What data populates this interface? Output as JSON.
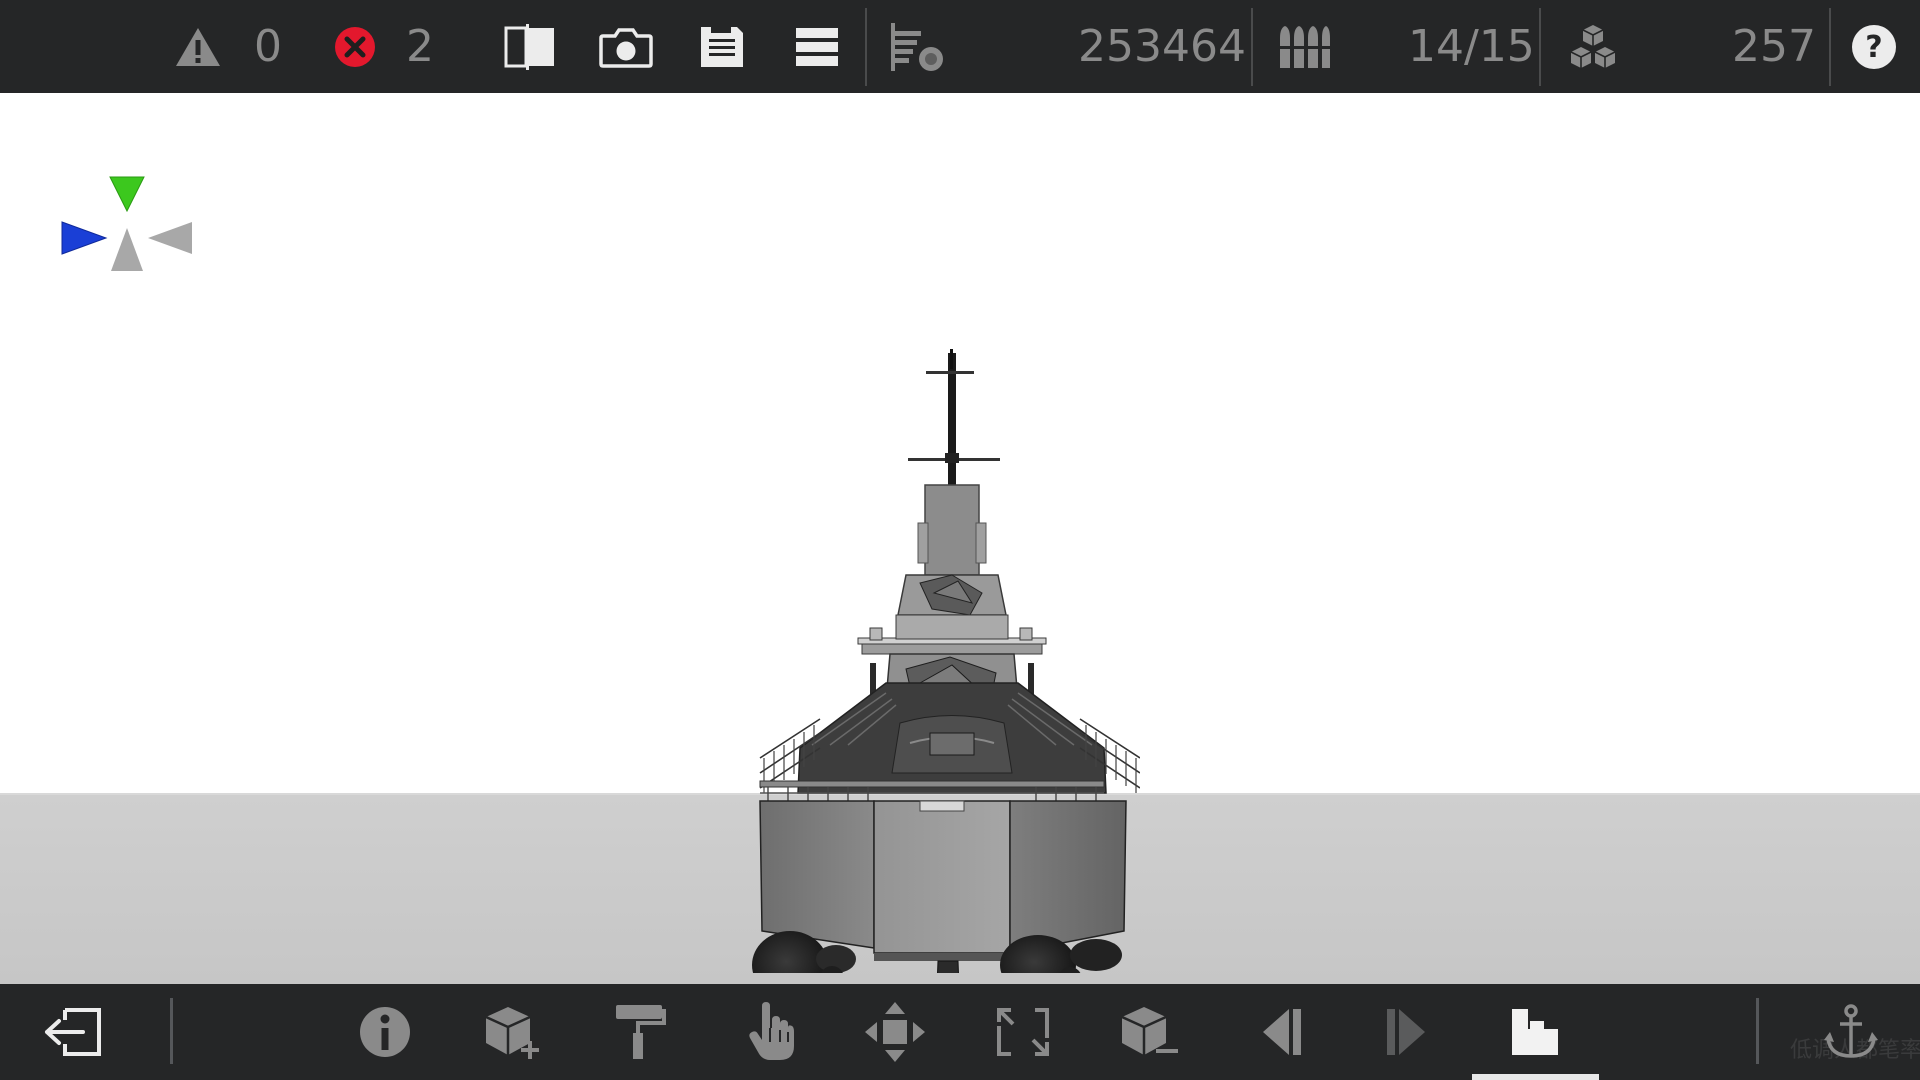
{
  "topbar": {
    "warning_count": "0",
    "error_count": "2",
    "stat_triangles": "253464",
    "stat_parts": "14/15",
    "stat_blocks": "257"
  },
  "icons": {
    "warning": "warning-triangle-icon",
    "error": "error-x-circle-icon",
    "split_view": "split-view-icon",
    "screenshot": "camera-icon",
    "save": "save-floppy-icon",
    "layers": "layers-menu-icon",
    "performance": "performance-bars-icon",
    "ammo": "ammo-shells-icon",
    "blocks": "blocks-stack-icon",
    "help": "help-question-icon",
    "exit": "exit-icon",
    "info": "info-icon",
    "add_block": "add-block-icon",
    "paint": "paint-roller-icon",
    "select": "hand-pointer-icon",
    "move": "move-arrows-icon",
    "scale": "scale-frame-icon",
    "remove_block": "remove-block-icon",
    "undo": "undo-triangle-icon",
    "redo": "redo-triangle-icon",
    "stack": "stack-blocks-icon",
    "anchor": "anchor-icon"
  },
  "colors": {
    "bar_bg": "#252627",
    "icon_gray": "#8a8a8a",
    "icon_white": "#ececec",
    "error_red": "#e3182d",
    "gizmo_green": "#3cc81e",
    "gizmo_blue": "#1a3fd6",
    "gizmo_gray": "#a8a8a8",
    "floor": "#c9c9c9"
  },
  "bottombar": {
    "watermark": "低调人都笔率"
  }
}
